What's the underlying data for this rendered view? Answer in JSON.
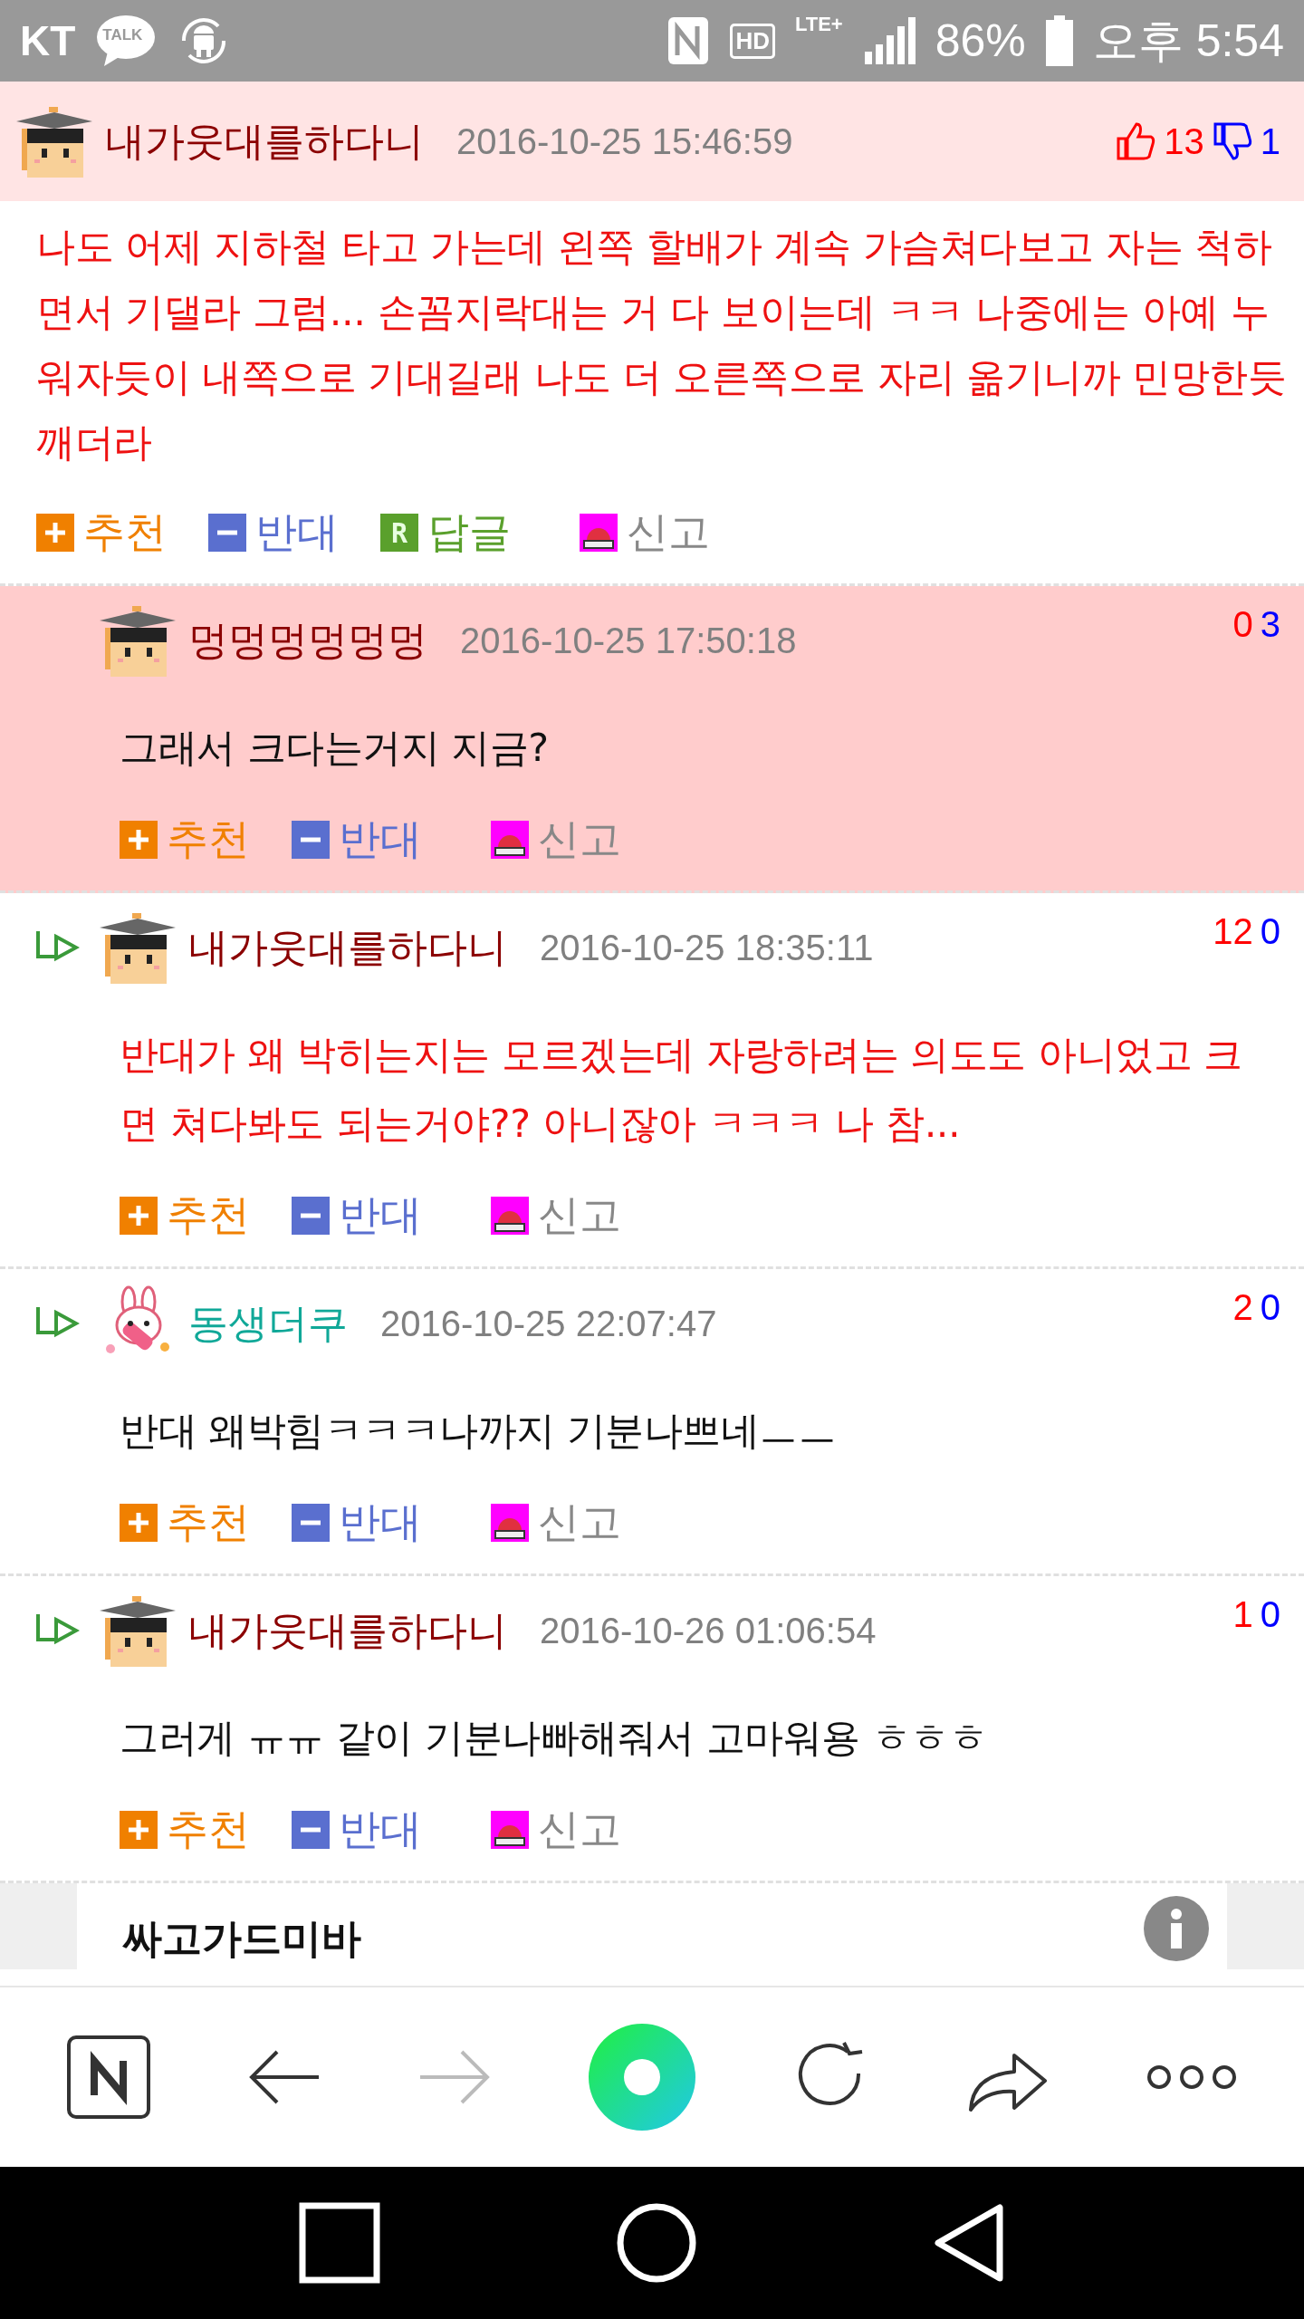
{
  "status_bar": {
    "carrier": "KT",
    "talk_label": "TALK",
    "hd_label": "HD",
    "lte_label": "LTE+",
    "battery": "86%",
    "time": "오후 5:54"
  },
  "comments": [
    {
      "kind": "top",
      "highlighted": false,
      "author": {
        "name": "내가웃대를하다니",
        "color": "#8b0000",
        "avatar": {
          "kind": "graduate"
        }
      },
      "date": "2016-10-25 15:46:59",
      "votes": {
        "kind": "thumbs",
        "up": "13",
        "down": "1"
      },
      "body": {
        "text": "나도 어제 지하철 타고 가는데 왼쪽 할배가 계속 가슴쳐다보고 자는 척하면서 기댈라 그럼... 손꼼지락대는 거 다 보이는데 ㅋㅋ 나중에는 아예 누워자듯이 내쪽으로 기대길래 나도 더 오른쪽으로 자리 옮기니까 민망한듯 깨더라",
        "color": "#ee1111"
      },
      "actions": [
        {
          "kind": "up",
          "label": "추천"
        },
        {
          "kind": "down",
          "label": "반대"
        },
        {
          "kind": "reply",
          "label": "답글",
          "badge": "R"
        },
        {
          "kind": "report",
          "label": "신고"
        }
      ]
    },
    {
      "kind": "reply",
      "show_arrow": false,
      "highlighted": true,
      "author": {
        "name": "멍멍멍멍멍멍",
        "color": "#8b0000",
        "avatar": {
          "kind": "graduate"
        }
      },
      "date": "2016-10-25 17:50:18",
      "votes": {
        "kind": "plain",
        "up": "0",
        "down": "3"
      },
      "body": {
        "text": "그래서 크다는거지 지금?",
        "color": "#111111"
      },
      "actions": [
        {
          "kind": "up",
          "label": "추천"
        },
        {
          "kind": "down",
          "label": "반대"
        },
        {
          "kind": "report",
          "label": "신고"
        }
      ]
    },
    {
      "kind": "reply",
      "show_arrow": true,
      "highlighted": false,
      "author": {
        "name": "내가웃대를하다니",
        "color": "#8b0000",
        "avatar": {
          "kind": "graduate"
        }
      },
      "date": "2016-10-25 18:35:11",
      "votes": {
        "kind": "plain",
        "up": "12",
        "down": "0"
      },
      "body": {
        "text": "반대가 왜 박히는지는 모르겠는데 자랑하려는 의도도 아니었고 크면 쳐다봐도 되는거야?? 아니잖아 ㅋㅋㅋ 나 참...",
        "color": "#ee1111"
      },
      "actions": [
        {
          "kind": "up",
          "label": "추천"
        },
        {
          "kind": "down",
          "label": "반대"
        },
        {
          "kind": "report",
          "label": "신고"
        }
      ]
    },
    {
      "kind": "reply",
      "show_arrow": true,
      "highlighted": false,
      "author": {
        "name": "동생더쿠",
        "color": "#10a898",
        "avatar": {
          "kind": "bunny"
        }
      },
      "date": "2016-10-25 22:07:47",
      "votes": {
        "kind": "plain",
        "up": "2",
        "down": "0"
      },
      "body": {
        "text": "반대 왜박힘ㅋㅋㅋ나까지 기분나쁘네ㅡㅡ",
        "color": "#111111"
      },
      "actions": [
        {
          "kind": "up",
          "label": "추천"
        },
        {
          "kind": "down",
          "label": "반대"
        },
        {
          "kind": "report",
          "label": "신고"
        }
      ]
    },
    {
      "kind": "reply",
      "show_arrow": true,
      "highlighted": false,
      "author": {
        "name": "내가웃대를하다니",
        "color": "#8b0000",
        "avatar": {
          "kind": "graduate"
        }
      },
      "date": "2016-10-26 01:06:54",
      "votes": {
        "kind": "plain",
        "up": "1",
        "down": "0"
      },
      "body": {
        "text": "그러게 ㅠㅠ 같이 기분나빠해줘서 고마워용 ㅎㅎㅎ",
        "color": "#111111"
      },
      "actions": [
        {
          "kind": "up",
          "label": "추천"
        },
        {
          "kind": "down",
          "label": "반대"
        },
        {
          "kind": "report",
          "label": "신고"
        }
      ]
    }
  ],
  "ad": {
    "title": "싸고가드미바"
  }
}
